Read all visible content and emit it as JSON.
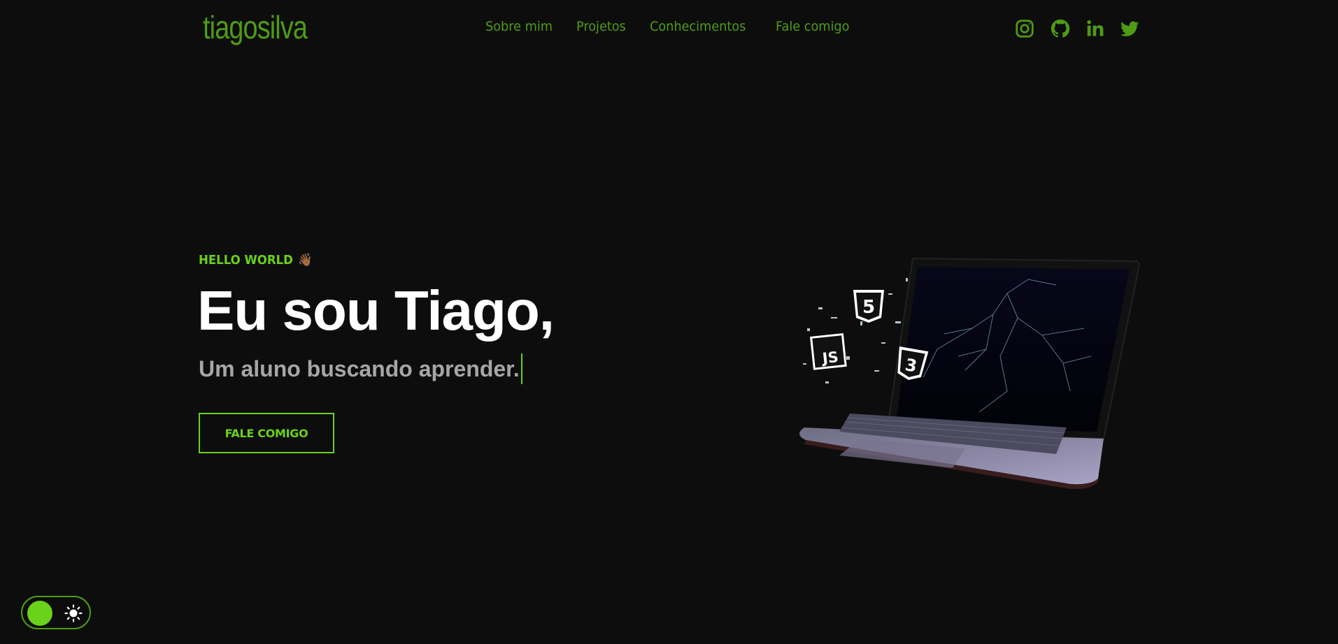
{
  "colors": {
    "accent": "#6ad21a",
    "accent_dim": "#4e9c14",
    "background": "#0d0d0d",
    "headline": "#ffffff",
    "subline": "#a6a6a6"
  },
  "header": {
    "logo": "tiagosilva",
    "nav": [
      {
        "label": "Sobre mim"
      },
      {
        "label": "Projetos"
      },
      {
        "label": "Conhecimentos"
      },
      {
        "label": "Fale comigo"
      }
    ],
    "social_icons": [
      "instagram-icon",
      "github-icon",
      "linkedin-icon",
      "twitter-icon"
    ]
  },
  "hero": {
    "greeting": "HELLO WORLD",
    "greeting_emoji": "👋🏾",
    "headline": "Eu sou Tiago,",
    "subline": "Um aluno buscando aprender.",
    "cta_label": "FALE COMIGO",
    "illustration_badges": [
      "5",
      "JS",
      "3"
    ]
  },
  "theme_toggle": {
    "icon": "sun-icon"
  }
}
